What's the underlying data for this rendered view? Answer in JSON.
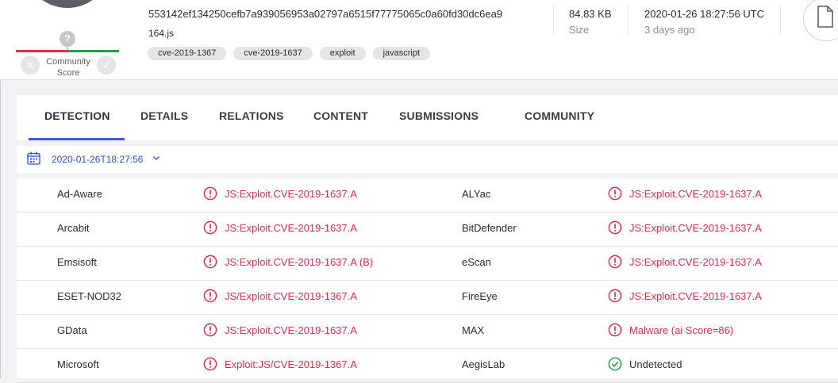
{
  "colors": {
    "accent": "#3b59e8",
    "malicious": "#e12d49",
    "clean": "#22a04b"
  },
  "header": {
    "community_score": {
      "badge": "?",
      "label_line1": "Community",
      "label_line2": "Score",
      "downvote_icon": "x-icon",
      "upvote_icon": "check-icon"
    },
    "hash": "553142ef134250cefb7a939056953a02797a6515f77775065c0a60fd30dc6ea9",
    "filename": "164.js",
    "tags": [
      "cve-2019-1367",
      "cve-2019-1637",
      "exploit",
      "javascript"
    ],
    "size": {
      "value": "84.83 KB",
      "label": "Size"
    },
    "date": {
      "value": "2020-01-26 18:27:56 UTC",
      "label": "3 days ago"
    },
    "file_type_icon": "document-icon"
  },
  "tabs": [
    {
      "label": "DETECTION",
      "active": true
    },
    {
      "label": "DETAILS",
      "active": false
    },
    {
      "label": "RELATIONS",
      "active": false
    },
    {
      "label": "CONTENT",
      "active": false
    },
    {
      "label": "SUBMISSIONS",
      "active": false
    },
    {
      "label": "COMMUNITY",
      "active": false
    }
  ],
  "analysis_date": {
    "value": "2020-01-26T18:27:56",
    "icon": "calendar-icon"
  },
  "detections": [
    {
      "left": {
        "engine": "Ad-Aware",
        "result": "JS:Exploit.CVE-2019-1637.A",
        "status": "malicious"
      },
      "right": {
        "engine": "ALYac",
        "result": "JS:Exploit.CVE-2019-1637.A",
        "status": "malicious"
      }
    },
    {
      "left": {
        "engine": "Arcabit",
        "result": "JS:Exploit.CVE-2019-1637.A",
        "status": "malicious"
      },
      "right": {
        "engine": "BitDefender",
        "result": "JS:Exploit.CVE-2019-1637.A",
        "status": "malicious"
      }
    },
    {
      "left": {
        "engine": "Emsisoft",
        "result": "JS:Exploit.CVE-2019-1637.A (B)",
        "status": "malicious"
      },
      "right": {
        "engine": "eScan",
        "result": "JS:Exploit.CVE-2019-1637.A",
        "status": "malicious"
      }
    },
    {
      "left": {
        "engine": "ESET-NOD32",
        "result": "JS/Exploit.CVE-2019-1367.A",
        "status": "malicious"
      },
      "right": {
        "engine": "FireEye",
        "result": "JS:Exploit.CVE-2019-1637.A",
        "status": "malicious"
      }
    },
    {
      "left": {
        "engine": "GData",
        "result": "JS:Exploit.CVE-2019-1637.A",
        "status": "malicious"
      },
      "right": {
        "engine": "MAX",
        "result": "Malware (ai Score=86)",
        "status": "malicious"
      }
    },
    {
      "left": {
        "engine": "Microsoft",
        "result": "Exploit:JS/CVE-2019-1367.A",
        "status": "malicious"
      },
      "right": {
        "engine": "AegisLab",
        "result": "Undetected",
        "status": "undetected"
      }
    }
  ]
}
